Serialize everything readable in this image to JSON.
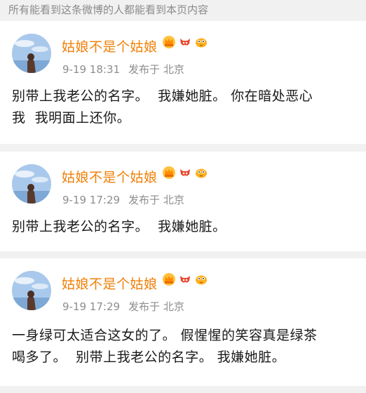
{
  "visibility_note": "所有能看到这条微博的人都能看到本页内容",
  "comments": [
    {
      "username": "姑娘不是个姑娘",
      "time": "9-19 18:31",
      "location": "发布于 北京",
      "text": "别带上我老公的名字。  我嫌她脏。 你在暗处恶心\n我  我明面上还你。",
      "badges": [
        "crown-badge-icon",
        "red-fox-badge-icon",
        "yellow-fish-badge-icon"
      ]
    },
    {
      "username": "姑娘不是个姑娘",
      "time": "9-19 17:29",
      "location": "发布于 北京",
      "text": "别带上我老公的名字。  我嫌她脏。",
      "badges": [
        "crown-badge-icon",
        "red-fox-badge-icon",
        "yellow-fish-badge-icon"
      ]
    },
    {
      "username": "姑娘不是个姑娘",
      "time": "9-19 17:29",
      "location": "发布于 北京",
      "text": "一身绿可太适合这女的了。 假惺惺的笑容真是绿茶\n喝多了。  别带上我老公的名字。 我嫌她脏。",
      "badges": [
        "crown-badge-icon",
        "red-fox-badge-icon",
        "yellow-fish-badge-icon"
      ]
    }
  ],
  "colors": {
    "username": "#f0800a",
    "meta": "#8d8d8d",
    "text": "#1a1a1a",
    "background": "#f1f1f1",
    "card": "#ffffff"
  }
}
